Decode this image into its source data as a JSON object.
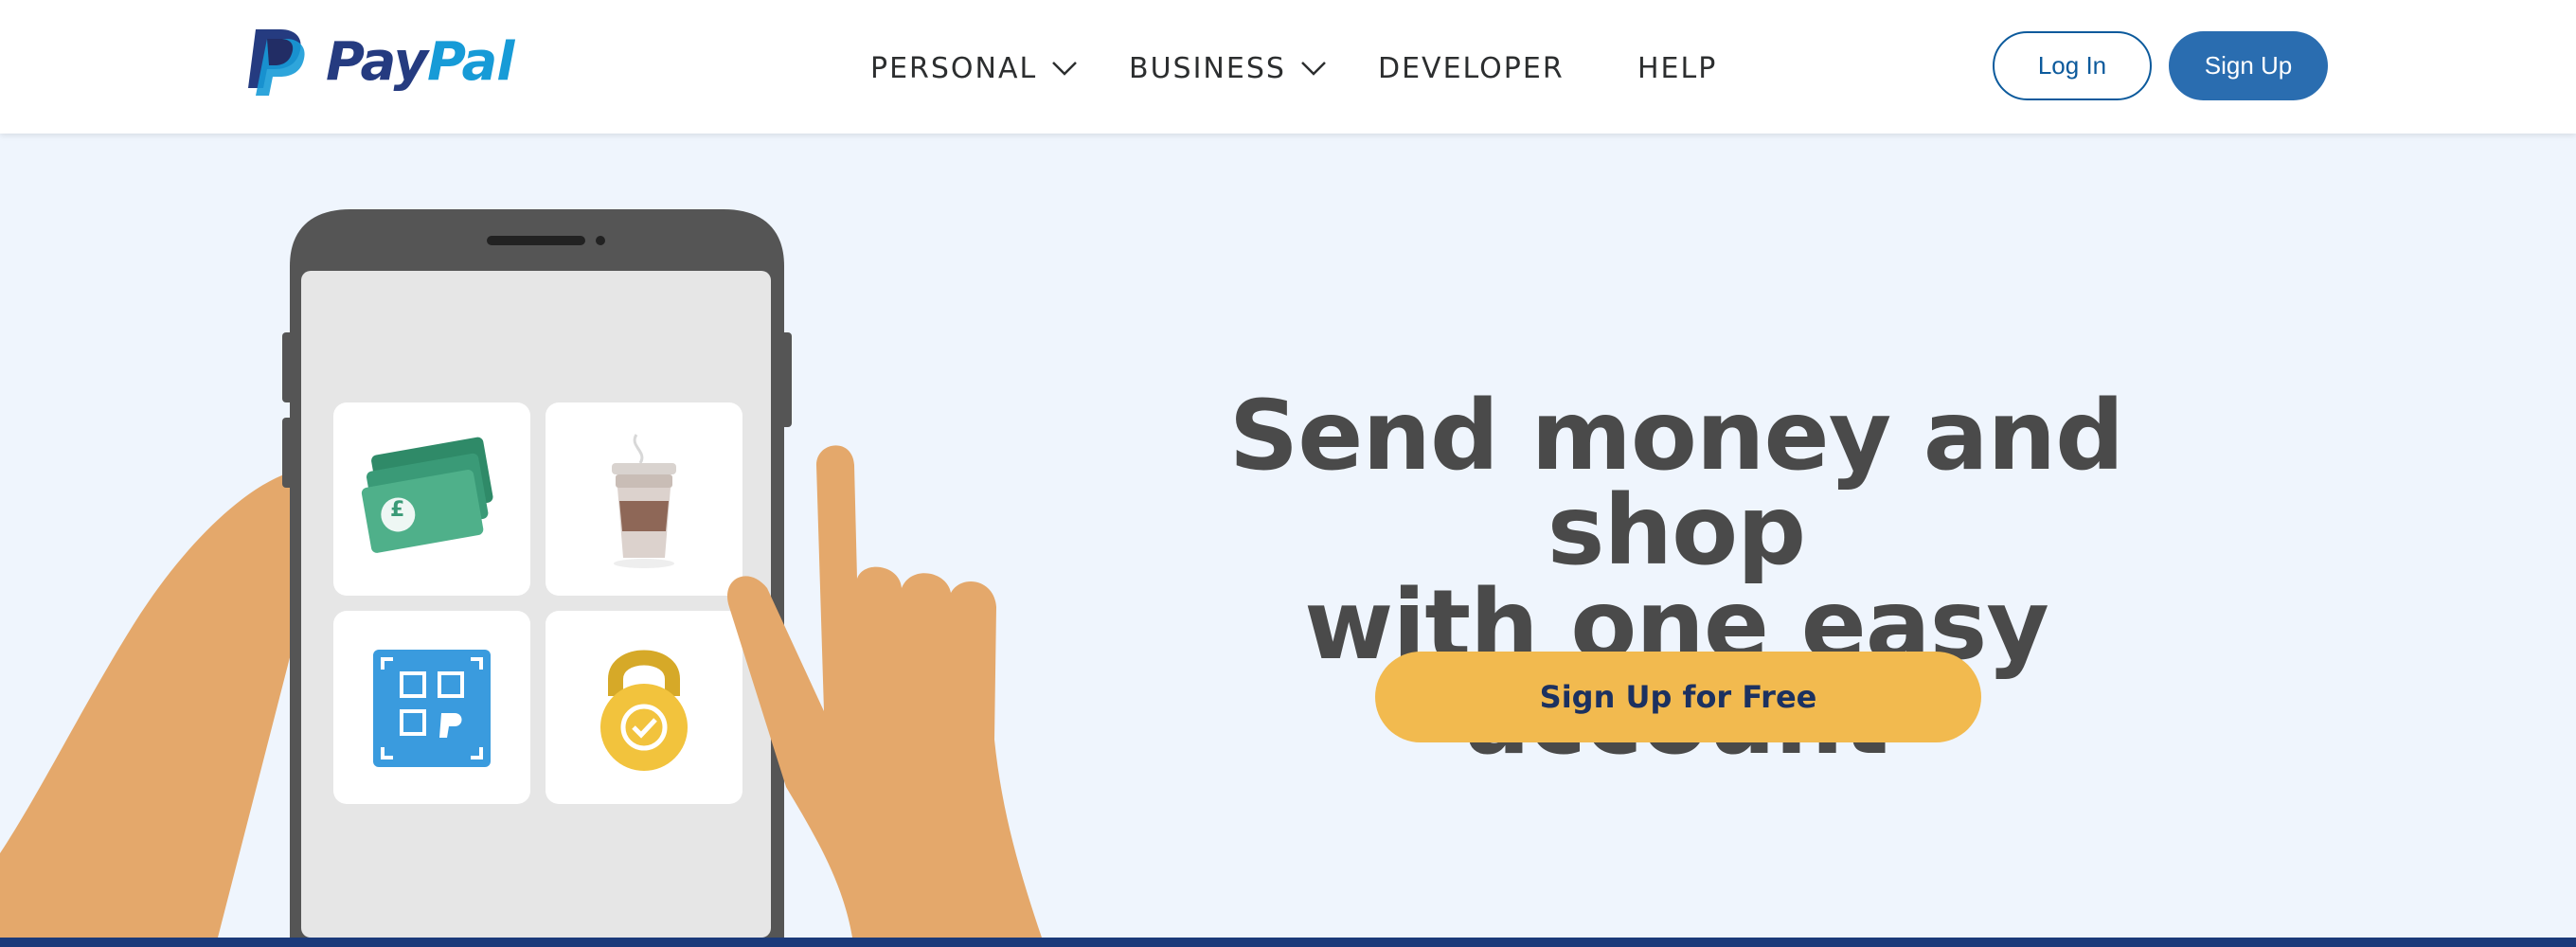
{
  "header": {
    "logo": {
      "pay": "Pay",
      "pal": "Pal",
      "icon": "paypal-mark-icon"
    },
    "nav": [
      {
        "label": "PERSONAL",
        "has_dropdown": true
      },
      {
        "label": "BUSINESS",
        "has_dropdown": true
      },
      {
        "label": "DEVELOPER",
        "has_dropdown": false
      },
      {
        "label": "HELP",
        "has_dropdown": false
      }
    ],
    "login_label": "Log In",
    "signup_label": "Sign Up"
  },
  "hero": {
    "headline_line1": "Send money and shop",
    "headline_line2": "with one easy account",
    "cta_label": "Sign Up for Free",
    "illustration": {
      "tiles": [
        "banknotes-icon",
        "coffee-cup-icon",
        "qr-code-icon",
        "padlock-check-icon"
      ],
      "banknote_symbol": "£"
    }
  },
  "colors": {
    "brand_dark_blue": "#253b80",
    "brand_light_blue": "#179bd7",
    "login_border": "#0c5a9c",
    "signup_bg": "#2a6db0",
    "cta_bg": "#f2ba4f",
    "cta_text": "#1c3160",
    "hero_bg": "#eff5fd",
    "headline_text": "#4a4a4a",
    "footer_strip": "#1b3a7a"
  }
}
